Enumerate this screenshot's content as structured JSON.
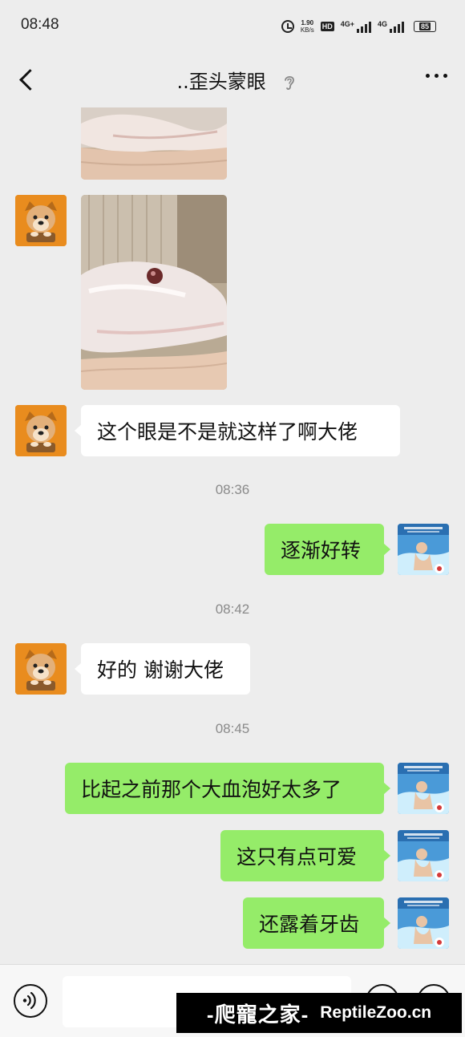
{
  "status_bar": {
    "time": "08:48",
    "net_speed_value": "1.90",
    "net_speed_unit": "KB/s",
    "hd_badge": "HD",
    "signal1_label": "4G+",
    "signal2_label": "4G",
    "battery": "85"
  },
  "nav": {
    "title": "..歪头蒙眼",
    "back_icon": "chevron-left-icon",
    "more_icon": "more-dots-icon",
    "earpiece_icon": "ear-icon"
  },
  "messages": {
    "m1_text": "这个眼是不是就这样了啊大佬",
    "time1": "08:36",
    "m2_text": "逐渐好转",
    "time2": "08:42",
    "m3_text": "好的 谢谢大佬",
    "time3": "08:45",
    "m4_text": "比起之前那个大血泡好太多了",
    "m5_text": "这只有点可爱",
    "m6_text": "还露着牙齿"
  },
  "watermark": {
    "cn": "-爬寵之家-",
    "en": "ReptileZoo.cn"
  },
  "colors": {
    "background": "#ededed",
    "outgoing_bubble": "#95ec69",
    "incoming_bubble": "#ffffff",
    "timestamp": "#8a8a8a"
  }
}
